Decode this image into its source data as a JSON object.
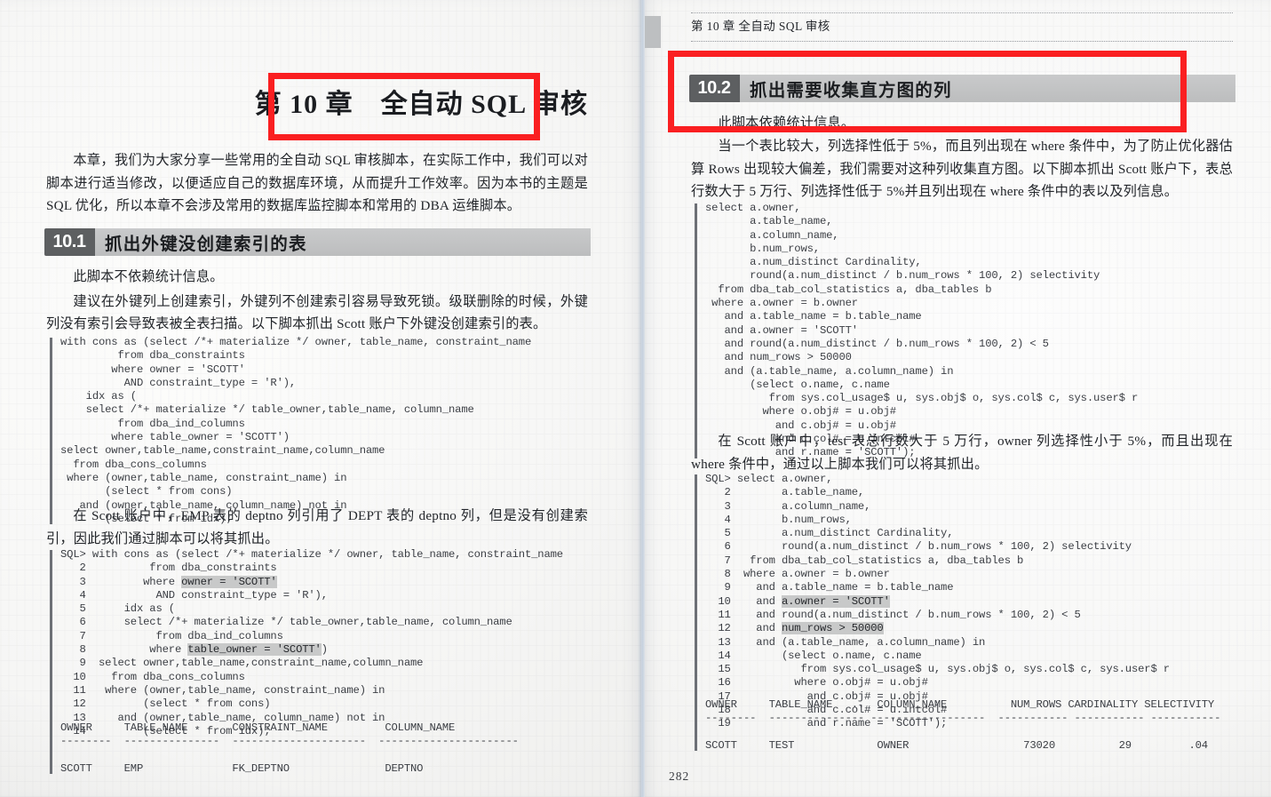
{
  "document": {
    "type": "book-scan-two-page-spread",
    "page_number": "282",
    "running_head": "第 10 章  全自动 SQL 审核",
    "accent_red": "#fa1f21",
    "section_bar_gray": "#c2c3c4",
    "section_num_gray": "#5d5f61"
  },
  "left_page": {
    "chapter_title": "第 10 章　全自动 SQL 审核",
    "intro_paragraph": "本章，我们为大家分享一些常用的全自动 SQL 审核脚本，在实际工作中，我们可以对脚本进行适当修改，以便适应自己的数据库环境，从而提升工作效率。因为本书的主题是 SQL 优化，所以本章不会涉及常用的数据库监控脚本和常用的 DBA 运维脚本。",
    "section": {
      "number": "10.1",
      "title": "抓出外键没创建索引的表"
    },
    "para_1": "此脚本不依赖统计信息。",
    "para_2": "建议在外键列上创建索引，外键列不创建索引容易导致死锁。级联删除的时候，外键列没有索引会导致表被全表扫描。以下脚本抓出 Scott 账户下外键没创建索引的表。",
    "code_1": "with cons as (select /*+ materialize */ owner, table_name, constraint_name\n         from dba_constraints\n        where owner = 'SCOTT'\n          AND constraint_type = 'R'),\n    idx as (\n    select /*+ materialize */ table_owner,table_name, column_name\n         from dba_ind_columns\n        where table_owner = 'SCOTT')\nselect owner,table_name,constraint_name,column_name\n  from dba_cons_columns\n where (owner,table_name, constraint_name) in\n       (select * from cons)\n   and (owner,table_name, column_name) not in\n       (select * from idx);",
    "para_3": "在 Scott 账户中，EMP 表的 deptno 列引用了 DEPT 表的 deptno 列，但是没有创建索引，因此我们通过脚本可以将其抓出。",
    "code_2_lines": [
      {
        "no": "SQL>",
        "text": " with cons as (select /*+ materialize */ owner, table_name, constraint_name"
      },
      {
        "no": "2",
        "text": "          from dba_constraints"
      },
      {
        "no": "3",
        "text": "         where ",
        "hl": "owner = 'SCOTT'"
      },
      {
        "no": "4",
        "text": "           AND constraint_type = 'R'),"
      },
      {
        "no": "5",
        "text": "      idx as ("
      },
      {
        "no": "6",
        "text": "      select /*+ materialize */ table_owner,table_name, column_name"
      },
      {
        "no": "7",
        "text": "           from dba_ind_columns"
      },
      {
        "no": "8",
        "text": "          where ",
        "hl": "table_owner = 'SCOTT'",
        "tail": ")"
      },
      {
        "no": "9",
        "text": "  select owner,table_name,constraint_name,column_name"
      },
      {
        "no": "10",
        "text": "    from dba_cons_columns"
      },
      {
        "no": "11",
        "text": "   where (owner,table_name, constraint_name) in"
      },
      {
        "no": "12",
        "text": "         (select * from cons)"
      },
      {
        "no": "13",
        "text": "     and (owner,table_name, column_name) not in"
      },
      {
        "no": "14",
        "text": "         (select * from idx);"
      }
    ],
    "result_table": {
      "headers": [
        "OWNER",
        "TABLE_NAME",
        "CONSTRAINT_NAME",
        "COLUMN_NAME"
      ],
      "rule": "--------  ---------------  ---------------------  ----------------------",
      "rows": [
        [
          "SCOTT",
          "EMP",
          "FK_DEPTNO",
          "DEPTNO"
        ]
      ]
    }
  },
  "right_page": {
    "section": {
      "number": "10.2",
      "title": "抓出需要收集直方图的列"
    },
    "para_0": "此脚本依赖统计信息。",
    "para_1": "当一个表比较大，列选择性低于 5%，而且列出现在 where 条件中，为了防止优化器估算 Rows 出现较大偏差，我们需要对这种列收集直方图。以下脚本抓出 Scott 账户下，表总行数大于 5 万行、列选择性低于 5%并且列出现在 where 条件中的表以及列信息。",
    "code_1": "select a.owner,\n       a.table_name,\n       a.column_name,\n       b.num_rows,\n       a.num_distinct Cardinality,\n       round(a.num_distinct / b.num_rows * 100, 2) selectivity\n  from dba_tab_col_statistics a, dba_tables b\n where a.owner = b.owner\n   and a.table_name = b.table_name\n   and a.owner = 'SCOTT'\n   and round(a.num_distinct / b.num_rows * 100, 2) < 5\n   and num_rows > 50000\n   and (a.table_name, a.column_name) in\n       (select o.name, c.name\n          from sys.col_usage$ u, sys.obj$ o, sys.col$ c, sys.user$ r\n         where o.obj# = u.obj#\n           and c.obj# = u.obj#\n           and c.col# = u.intcol#\n           and r.name = 'SCOTT');",
    "para_2": "在 Scott 账户中，test 表总行数大于 5 万行，owner 列选择性小于 5%，而且出现在 where 条件中，通过以上脚本我们可以将其抓出。",
    "code_2_lines": [
      {
        "no": "SQL>",
        "text": " select a.owner,"
      },
      {
        "no": "2",
        "text": "        a.table_name,"
      },
      {
        "no": "3",
        "text": "        a.column_name,"
      },
      {
        "no": "4",
        "text": "        b.num_rows,"
      },
      {
        "no": "5",
        "text": "        a.num_distinct Cardinality,"
      },
      {
        "no": "6",
        "text": "        round(a.num_distinct / b.num_rows * 100, 2) selectivity"
      },
      {
        "no": "7",
        "text": "   from dba_tab_col_statistics a, dba_tables b"
      },
      {
        "no": "8",
        "text": "  where a.owner = b.owner"
      },
      {
        "no": "9",
        "text": "    and a.table_name = b.table_name"
      },
      {
        "no": "10",
        "text": "    and ",
        "hl": "a.owner = 'SCOTT'"
      },
      {
        "no": "11",
        "text": "    and round(a.num_distinct / b.num_rows * 100, 2) < 5"
      },
      {
        "no": "12",
        "text": "    and ",
        "hl": "num_rows > 50000"
      },
      {
        "no": "13",
        "text": "    and (a.table_name, a.column_name) in"
      },
      {
        "no": "14",
        "text": "        (select o.name, c.name"
      },
      {
        "no": "15",
        "text": "           from sys.col_usage$ u, sys.obj$ o, sys.col$ c, sys.user$ r"
      },
      {
        "no": "16",
        "text": "          where o.obj# = u.obj#"
      },
      {
        "no": "17",
        "text": "            and c.obj# = u.obj#"
      },
      {
        "no": "18",
        "text": "            and c.col# = u.intcol#"
      },
      {
        "no": "19",
        "text": "            and r.name = 'SCOTT');"
      }
    ],
    "result_table": {
      "headers_line": "OWNER     TABLE_NAME   ..  COLUMN_NAME          NUM_ROWS CARDINALITY SELECTIVITY",
      "rule": "--------  --------------- ------------------  ----------- ----------- -----------",
      "row_line": "SCOTT     TEST             OWNER                  73020          29         .04",
      "headers": [
        "OWNER",
        "TABLE_NAME",
        "..",
        "COLUMN_NAME",
        "NUM_ROWS",
        "CARDINALITY",
        "SELECTIVITY"
      ],
      "rows": [
        [
          "SCOTT",
          "TEST",
          "",
          "OWNER",
          "73020",
          "29",
          ".04"
        ]
      ]
    }
  },
  "annotations": {
    "boxes": [
      {
        "name": "chapter-title-highlight",
        "label": "第 10 章　全自动 SQL 审核",
        "color": "#fa1f21"
      },
      {
        "name": "section-10-2-highlight",
        "label": "10.2 抓出需要收集直方图的列",
        "color": "#fa1f21"
      }
    ]
  }
}
